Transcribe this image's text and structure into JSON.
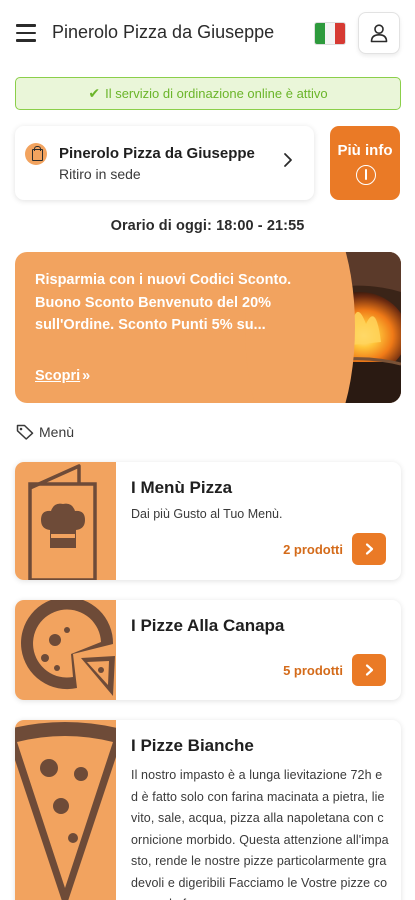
{
  "header": {
    "brand": "Pinerolo Pizza da Giuseppe",
    "menu_icon": "hamburger-menu-icon",
    "language_flag": "italy-flag-icon",
    "user_icon": "user-icon"
  },
  "service_status": {
    "text": "Il servizio di ordinazione online è attivo",
    "icon": "checkmark-icon",
    "color": "#6bb52a"
  },
  "store": {
    "name": "Pinerolo Pizza da Giuseppe",
    "mode": "Ritiro in sede",
    "icon": "shopping-bag-icon"
  },
  "info_button": {
    "label": "Più info",
    "icon": "info-icon"
  },
  "hours": "Orario di oggi: 18:00 - 21:55",
  "promo": {
    "text": "Risparmia con i nuovi Codici Sconto. Buono Sconto Benvenuto del 20% sull'Ordine. Sconto Punti 5% su...",
    "link": "Scopri",
    "link_icon": "double-chevron-right-icon",
    "image": "pizza-oven-fire-photo"
  },
  "section": {
    "label": "Menù",
    "icon": "tag-icon"
  },
  "categories": [
    {
      "title": "I Menù Pizza",
      "subtitle": "Dai più Gusto al Tuo Menù.",
      "count": "2 prodotti",
      "thumb_icon": "menu-card-chef-hat-icon"
    },
    {
      "title": "I Pizze Alla Canapa",
      "count": "5 prodotti",
      "thumb_icon": "pizza-icon"
    },
    {
      "title": "I Pizze Bianche",
      "description": "Il nostro impasto è a lunga lievitazione 72h ed è fatto solo con farina macinata a pietra, lievito, sale, acqua, pizza alla napoletana con cornicione morbido. Questa attenzione all'impasto, rende le nostre pizze particolarmente gradevoli e digeribili Facciamo le Vostre pizze come se le fac",
      "thumb_icon": "pizza-slice-icon"
    }
  ],
  "colors": {
    "accent": "#ea7a26",
    "accent_light": "#f2a35f",
    "success": "#8bcf4a",
    "success_bg": "#eaf6d9",
    "count_text": "#d46b1a"
  }
}
